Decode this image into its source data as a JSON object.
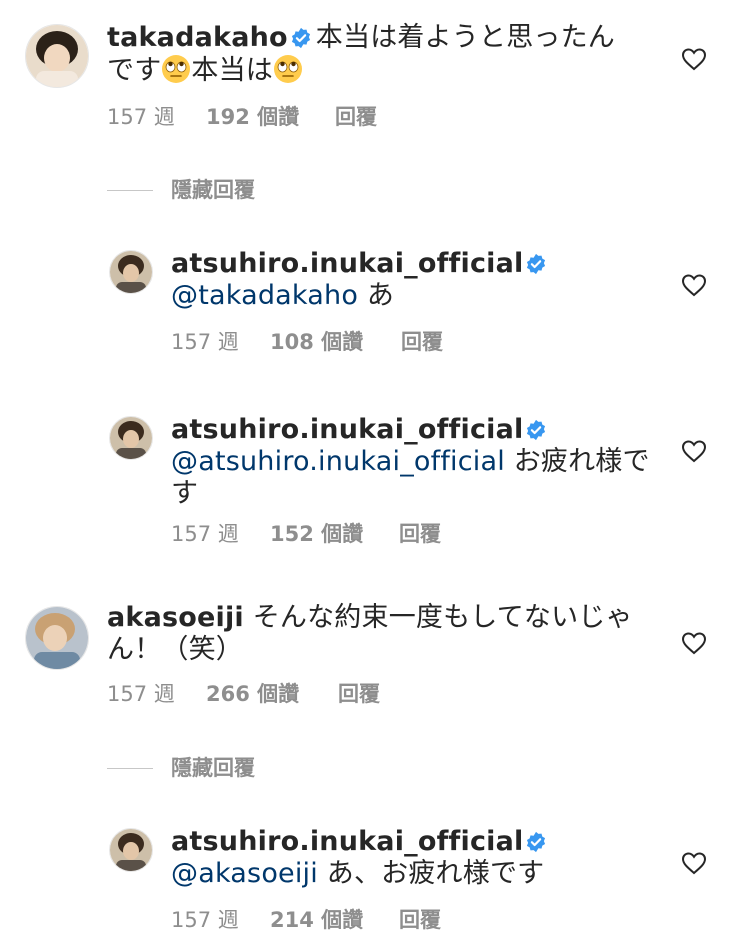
{
  "comments": [
    {
      "username": "takadakaho",
      "text_line1": "本当は着ようと思ったん",
      "text_line2a": "です",
      "text_line2b": "本当は",
      "emoji": "face-with-rolling-eyes",
      "time": "157 週",
      "likes": "192 個讚",
      "reply": "回覆"
    },
    {
      "username": "atsuhiro.inukai_official",
      "mention": "@takadakaho",
      "text": " あ",
      "time": "157 週",
      "likes": "108 個讚",
      "reply": "回覆"
    },
    {
      "username": "atsuhiro.inukai_official",
      "mention": "@atsuhiro.inukai_official",
      "text": " お疲れ様で",
      "text_line2": "す",
      "time": "157 週",
      "likes": "152 個讚",
      "reply": "回覆"
    },
    {
      "username": "akasoeiji",
      "text_line1": "そんな約束一度もしてないじゃ",
      "text_line2": "ん！（笑）",
      "time": "157 週",
      "likes": "266 個讚",
      "reply": "回覆"
    },
    {
      "username": "atsuhiro.inukai_official",
      "mention": "@akasoeiji",
      "text": " あ、お疲れ様です",
      "time": "157 週",
      "likes": "214 個讚",
      "reply": "回覆"
    }
  ],
  "hide_replies_label": "隱藏回覆",
  "colors": {
    "text": "#262626",
    "meta": "#8e8e8e",
    "mention": "#00376b",
    "verified": "#3897f0"
  }
}
